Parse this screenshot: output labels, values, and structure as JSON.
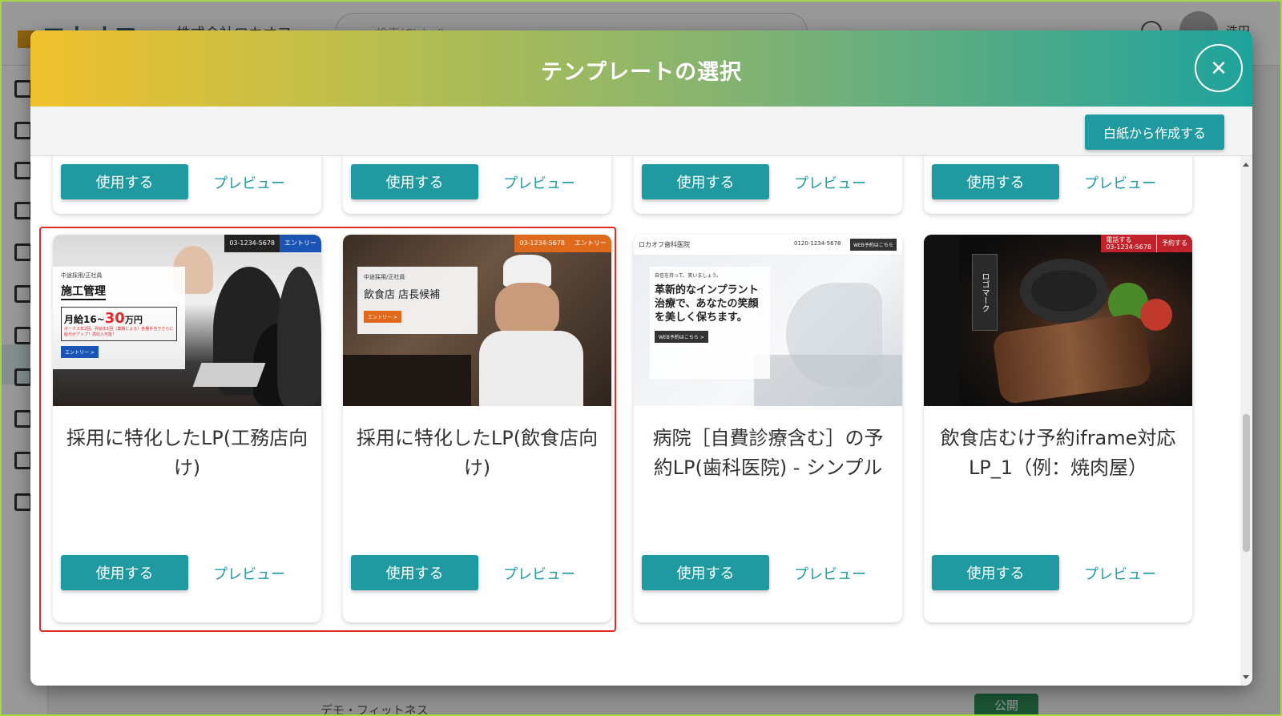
{
  "modal": {
    "title": "テンプレートの選択",
    "close_label": "×",
    "blank_button": "白紙から作成する"
  },
  "actions": {
    "use_label": "使用する",
    "preview_label": "プレビュー"
  },
  "templates": [
    {
      "title": "採用に特化したLP(工務店向け)",
      "thumb": {
        "tag": "中途採用/正社員",
        "heading": "施工管理",
        "salary_prefix": "月給16~",
        "salary_main": "30",
        "salary_suffix": "万円",
        "note": "ボーナス年2回、昇給年1回（業績による）各種手当でさらに給与がアップ！高収入可能！",
        "entry": "エントリー >",
        "tel": "03-1234-5678",
        "entry_top": "エントリー"
      }
    },
    {
      "title": "採用に特化したLP(飲食店向け)",
      "thumb": {
        "tag": "中途採用/正社員",
        "heading": "飲食店 店長候補",
        "entry": "エントリー >",
        "tel": "03-1234-5678",
        "entry_top": "エントリー"
      }
    },
    {
      "title": "病院［自費診療含む］の予約LP(歯科医院) - シンプル",
      "thumb": {
        "clinic": "ロカオフ歯科医院",
        "tel": "0120-1234-5678",
        "web_button": "WEB予約はこちら",
        "intro": "自信を持って、笑いましょう。",
        "heading": "革新的なインプラント治療で、あなたの笑顔を美しく保ちます。",
        "cta": "WEB予約はこちら >"
      }
    },
    {
      "title": "飲食店むけ予約iframe対応LP_1（例：焼肉屋）",
      "thumb": {
        "logo": "ロゴマーク",
        "call": "電話する",
        "tel": "03-1234-5678",
        "reserve": "予約する"
      }
    }
  ],
  "background": {
    "logo": "ロカオフ",
    "company": "株式会社ロカオフ",
    "search_placeholder": "検索(Ctrl+/)",
    "user": "浩田",
    "publish": "公開",
    "row_text": "デモ・フィットネス"
  },
  "colors": {
    "accent": "#1f9aa0",
    "highlight": "#e02a2a",
    "header_gradient": [
      "#f1c12d",
      "#b6be50",
      "#7fb274",
      "#1ea39c"
    ]
  }
}
